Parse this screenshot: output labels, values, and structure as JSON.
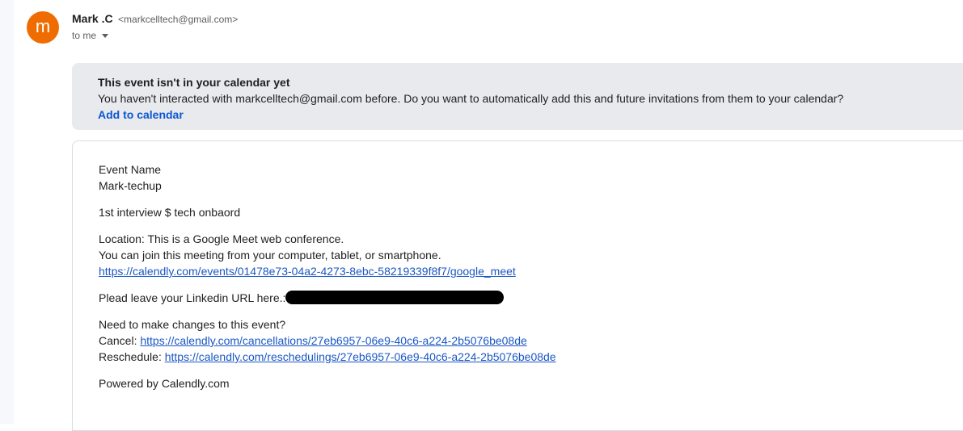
{
  "sender": {
    "avatar_letter": "m",
    "name": "Mark .C",
    "email": "<markcelltech@gmail.com>",
    "to": "to me",
    "avatar_color": "#ef6c00"
  },
  "calendar_banner": {
    "title": "This event isn't in your calendar yet",
    "message": "You haven't interacted with markcelltech@gmail.com before. Do you want to automatically add this and future invitations from them to your calendar?",
    "action": "Add to calendar"
  },
  "event": {
    "name_label": "Event Name",
    "name_value": "Mark-techup",
    "description": "1st interview $ tech onbaord",
    "location": "Location: This is a Google Meet web conference.",
    "join_text": "You can join this meeting from your computer, tablet, or smartphone.",
    "meet_link": "https://calendly.com/events/01478e73-04a2-4273-8ebc-58219339f8f7/google_meet",
    "linkedin_prompt": "Plead leave your Linkedin URL here.:",
    "changes_prompt": "Need to make changes to this event?",
    "cancel_label": "Cancel:",
    "cancel_link": "https://calendly.com/cancellations/27eb6957-06e9-40c6-a224-2b5076be08de",
    "reschedule_label": "Reschedule:",
    "reschedule_link": "https://calendly.com/reschedulings/27eb6957-06e9-40c6-a224-2b5076be08de",
    "powered_by": "Powered by Calendly.com"
  },
  "colors": {
    "link": "#1a57c4",
    "banner_bg": "#e9eaee",
    "banner_link": "#0b57d0"
  }
}
